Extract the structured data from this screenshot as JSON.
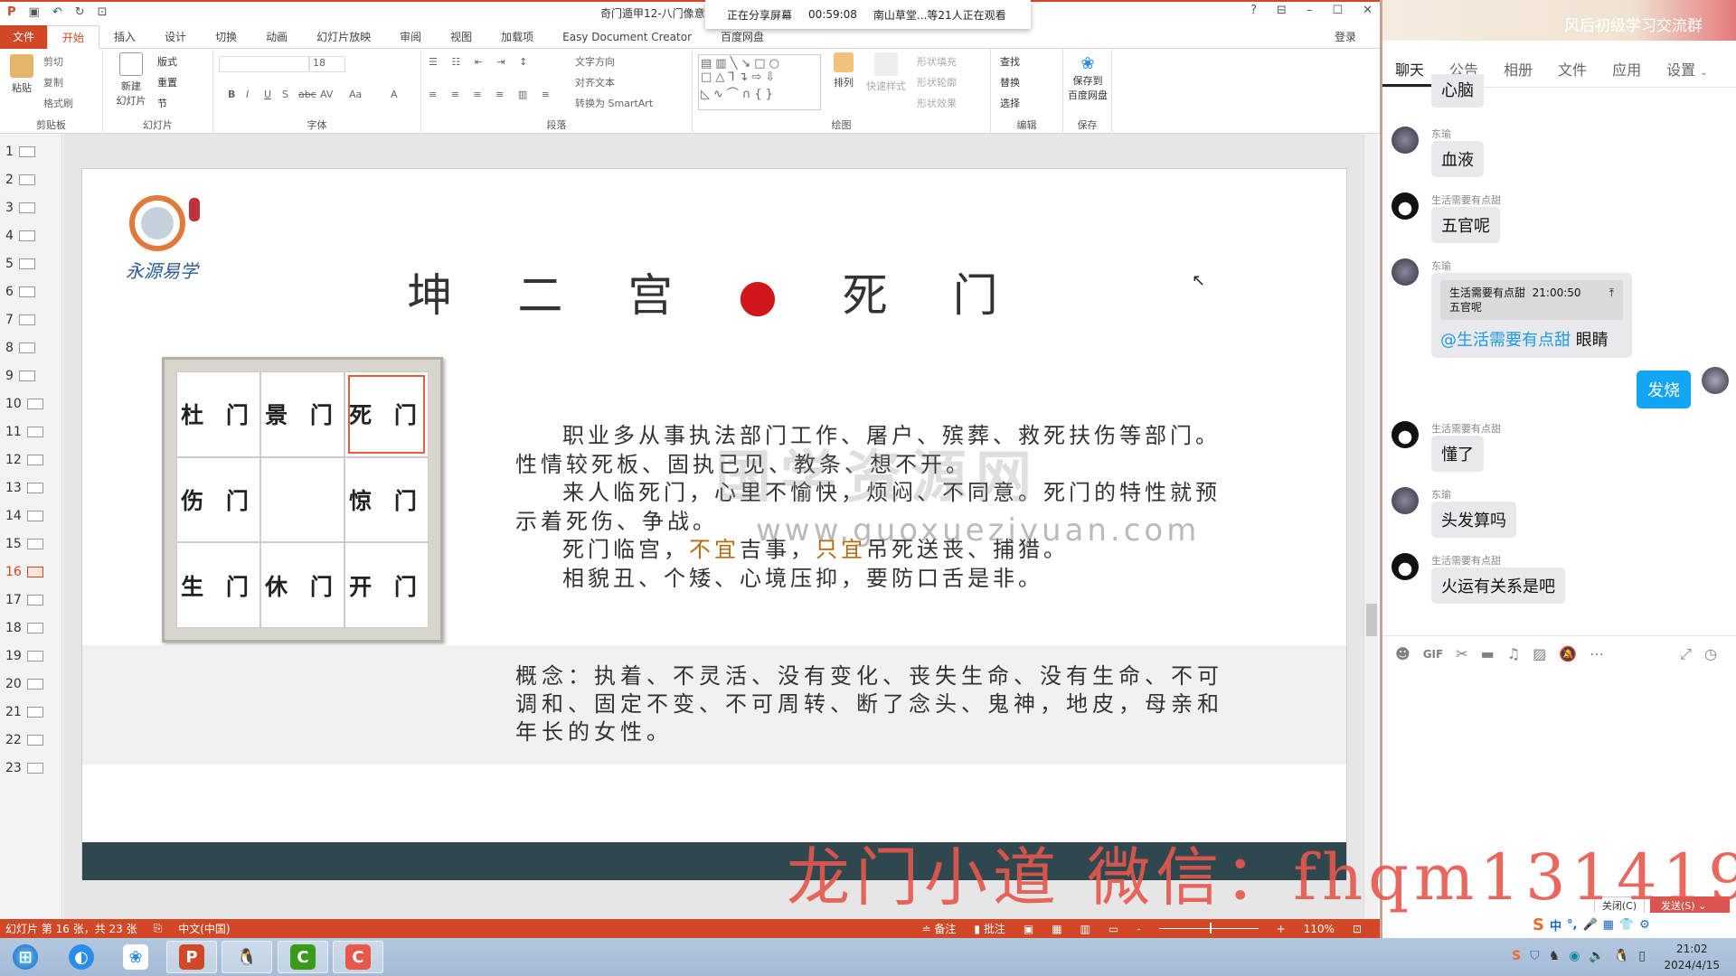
{
  "titlebar": {
    "doc_title": "奇门遁甲12-八门像意",
    "share_status": "正在分享屏幕",
    "share_time": "00:59:08",
    "viewers": "南山草堂...等21人正在观看",
    "help": "?",
    "quick_access": [
      "save",
      "undo",
      "redo",
      "present"
    ]
  },
  "tabs": [
    "文件",
    "开始",
    "插入",
    "设计",
    "切换",
    "动画",
    "幻灯片放映",
    "审阅",
    "视图",
    "加载项",
    "Easy Document Creator",
    "百度网盘"
  ],
  "active_tab": "开始",
  "login": "登录",
  "ribbon": {
    "clipboard": {
      "label": "剪贴板",
      "paste": "粘贴",
      "cut": "剪切",
      "copy": "复制",
      "format_painter": "格式刷"
    },
    "slides": {
      "label": "幻灯片",
      "new_slide": "新建\n幻灯片",
      "layout": "版式",
      "reset": "重置",
      "section": "节"
    },
    "font": {
      "label": "字体",
      "size": "18",
      "bold": "B",
      "italic": "I",
      "underline": "U",
      "shadow": "S",
      "strike": "abc",
      "spacing": "AV",
      "case": "Aa",
      "color": "A"
    },
    "paragraph": {
      "label": "段落",
      "text_direction": "文字方向",
      "align_text": "对齐文本",
      "smartart": "转换为 SmartArt"
    },
    "drawing": {
      "label": "绘图",
      "arrange": "排列",
      "quick_styles": "快速样式",
      "shape_fill": "形状填充",
      "shape_outline": "形状轮廓",
      "shape_effects": "形状效果"
    },
    "editing": {
      "label": "编辑",
      "find": "查找",
      "replace": "替换",
      "select": "选择"
    },
    "save": {
      "label": "保存",
      "save_baidu": "保存到\n百度网盘"
    }
  },
  "thumbnails": [
    "1",
    "2",
    "3",
    "4",
    "5",
    "6",
    "7",
    "8",
    "9",
    "10",
    "11",
    "12",
    "13",
    "14",
    "15",
    "16",
    "17",
    "18",
    "19",
    "20",
    "21",
    "22",
    "23"
  ],
  "current_slide": 16,
  "slide": {
    "logo_text": "永源易学",
    "logo_seal": "易学",
    "title_left": "坤 二 宫",
    "title_right": "死 门",
    "grid": [
      "杜 门",
      "景 门",
      "死 门",
      "伤 门",
      "",
      "惊 门",
      "生 门",
      "休 门",
      "开 门"
    ],
    "highlighted_cell": "死 门",
    "paragraphs": [
      {
        "text": "职业多从事执法部门工作、屠户、殡葬、救死扶伤等部门。性情较死板、固执己见、教条、想不开。"
      },
      {
        "text": "来人临死门，心里不愉快，烦闷、不同意。死门的特性就预示着死伤、争战。"
      },
      {
        "p1": "死门临宫，",
        "h1": "不宜",
        "p2": "吉事，",
        "h2": "只宜",
        "p3": "吊死送丧、捕猎。"
      },
      {
        "text": "相貌丑、个矮、心境压抑，要防口舌是非。"
      }
    ],
    "concept": "概念：执着、不灵活、没有变化、丧失生命、没有生命、不可调和、固定不变、不可周转、断了念头、鬼神，地皮，母亲和年长的女性。",
    "site_watermark": "国学资源网",
    "site_url": "www.guoxueziyuan.com"
  },
  "overlay_watermark": "龙门小道  微信：fhqm131419",
  "statusbar": {
    "slide_info": "幻灯片 第 16 张，共 23 张",
    "language": "中文(中国)",
    "notes": "备注",
    "comments": "批注",
    "zoom": "110%",
    "zoom_percent": 110
  },
  "chat": {
    "group_name": "风后初级学习交流群",
    "tabs": [
      "聊天",
      "公告",
      "相册",
      "文件",
      "应用",
      "设置"
    ],
    "messages": [
      {
        "sender": "",
        "text": "心脑"
      },
      {
        "sender": "东瑜",
        "text": "血液"
      },
      {
        "sender": "生活需要有点甜",
        "text": "五官呢"
      },
      {
        "sender": "东瑜",
        "quote_sender": "生活需要有点甜",
        "quote_time": "21:00:50",
        "quote_text": "五官呢",
        "mention": "@生活需要有点甜",
        "text": "眼睛"
      },
      {
        "sender": "me",
        "text": "发烧"
      },
      {
        "sender": "生活需要有点甜",
        "text": "懂了"
      },
      {
        "sender": "东瑜",
        "text": "头发算吗"
      },
      {
        "sender": "生活需要有点甜",
        "text": "火运有关系是吧"
      }
    ],
    "tools": [
      "emoji",
      "GIF",
      "scissors",
      "folder",
      "music",
      "image",
      "bell-off",
      "more",
      "expand",
      "clock"
    ],
    "close_button": "关闭(C)",
    "send_button": "发送(S)"
  },
  "ime": {
    "lang": "中"
  },
  "clock": {
    "time": "21:02",
    "date": "2024/4/15"
  },
  "colors": {
    "ppt_accent": "#d24726",
    "chat_blue": "#12a5f3",
    "watermark_red": "#e8574d",
    "slide_dark_bar": "#2f4850"
  }
}
